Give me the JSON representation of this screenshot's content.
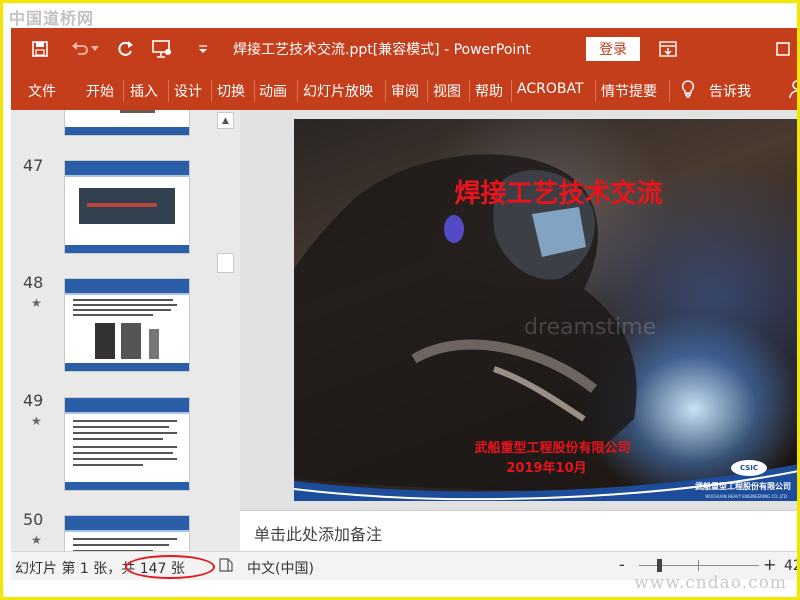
{
  "watermarks": {
    "top": "中国道桥网",
    "bottom": "www.cndao.com",
    "slide": "dreamstime"
  },
  "titlebar": {
    "title": "焊接工艺技术交流.ppt[兼容模式]  -  PowerPoint",
    "login_label": "登录",
    "icons": [
      "save-icon",
      "undo-icon",
      "redo-icon",
      "present-from-start-icon",
      "customize-toolbar-icon",
      "ribbon-display-icon",
      "maximize-icon"
    ]
  },
  "ribbon": {
    "tabs": [
      "文件",
      "开始",
      "插入",
      "设计",
      "切换",
      "动画",
      "幻灯片放映",
      "审阅",
      "视图",
      "帮助",
      "ACROBAT",
      "情节提要"
    ],
    "tell_me": "告诉我"
  },
  "thumbnails": [
    {
      "number": "47",
      "star": ""
    },
    {
      "number": "48",
      "star": "★"
    },
    {
      "number": "49",
      "star": "★"
    },
    {
      "number": "50",
      "star": "★"
    }
  ],
  "slide": {
    "title": "焊接工艺技术交流",
    "company": "武船重型工程股份有限公司",
    "date": "2019年10月",
    "logo_text": "CSIC",
    "footer_cn": "武船重型工程股份有限公司",
    "footer_en": "WUCHUAN HEAVY ENGINEERING CO.,LTD"
  },
  "notes": {
    "placeholder": "单击此处添加备注"
  },
  "statusbar": {
    "slide_info": "幻灯片 第 1 张，共 147 张",
    "language": "中文(中国)",
    "zoom_minus": "-",
    "zoom_plus": "+",
    "zoom_percent": "42"
  },
  "colors": {
    "accent": "#c43e1c",
    "slide_text": "#e8141b",
    "annotation_circle": "#e5161d",
    "frame": "#f2e600"
  }
}
